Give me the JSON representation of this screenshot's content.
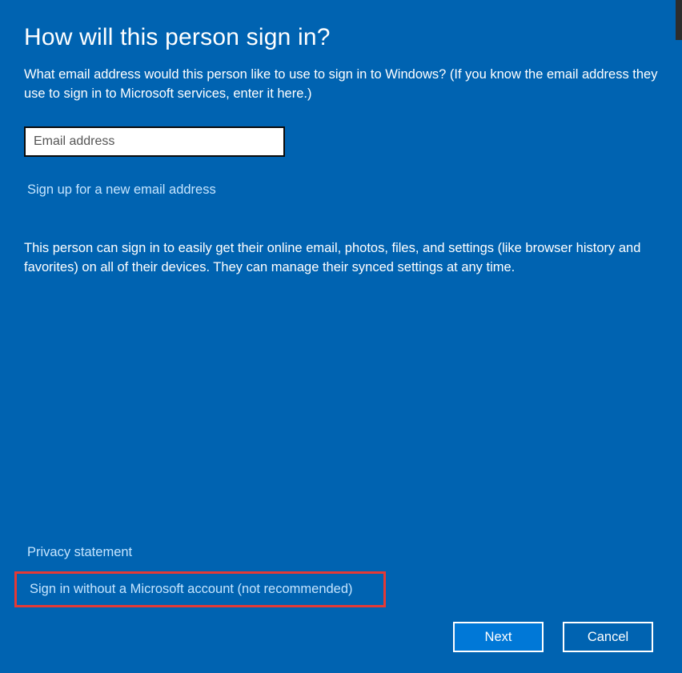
{
  "heading": "How will this person sign in?",
  "subheading": "What email address would this person like to use to sign in to Windows? (If you know the email address they use to sign in to Microsoft services, enter it here.)",
  "email_input": {
    "placeholder": "Email address",
    "value": ""
  },
  "signup_link": "Sign up for a new email address",
  "description": "This person can sign in to easily get their online email, photos, files, and settings (like browser history and favorites) on all of their devices. They can manage their synced settings at any time.",
  "privacy_link": "Privacy statement",
  "signin_without_link": "Sign in without a Microsoft account (not recommended)",
  "buttons": {
    "next": "Next",
    "cancel": "Cancel"
  }
}
